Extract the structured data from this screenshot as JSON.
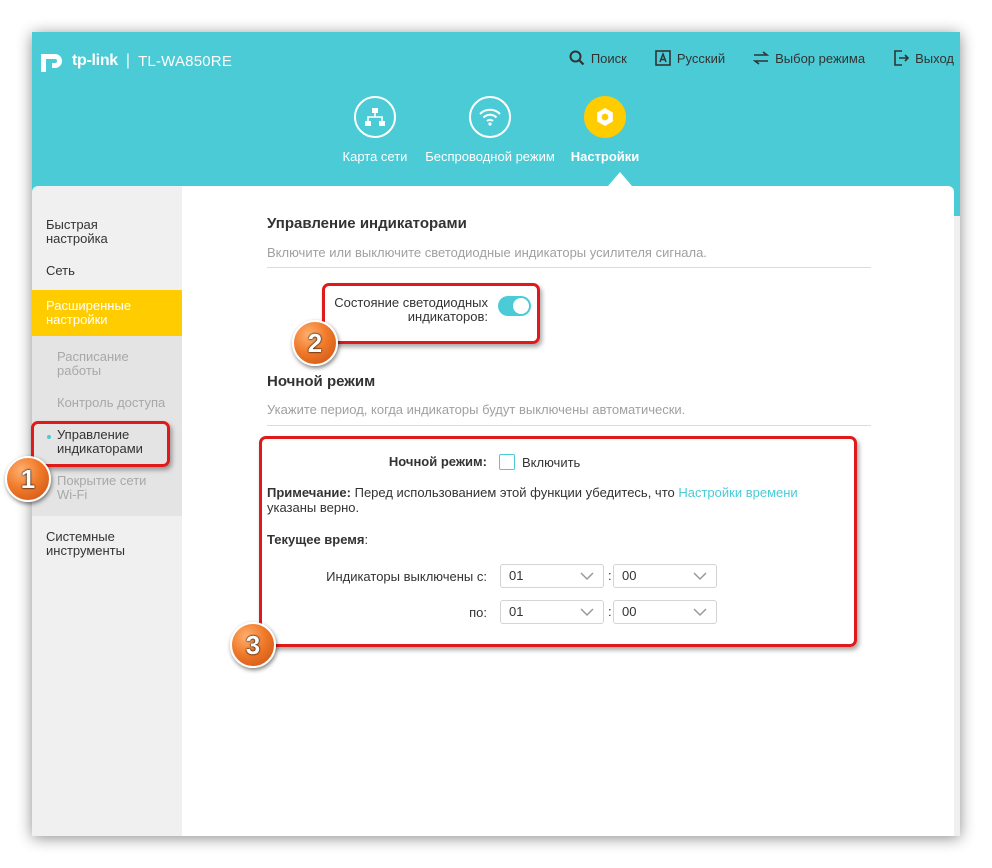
{
  "header": {
    "brand": "tp-link",
    "model": "TL-WA850RE",
    "top_menu": {
      "search": "Поиск",
      "language": "Русский",
      "mode": "Выбор режима",
      "logout": "Выход"
    },
    "nav": [
      {
        "label": "Карта сети"
      },
      {
        "label": "Беспроводной режим"
      },
      {
        "label": "Настройки"
      }
    ]
  },
  "sidebar": {
    "quick": "Быстрая настройка",
    "network": "Сеть",
    "advanced": "Расширенные настройки",
    "sub": {
      "schedule": "Расписание работы",
      "access": "Контроль доступа",
      "led": "Управление индикаторами",
      "coverage": "Покрытие сети Wi-Fi"
    },
    "tools": "Системные инструменты"
  },
  "main": {
    "led_title": "Управление индикаторами",
    "led_desc": "Включите или выключите светодиодные индикаторы усилителя сигнала.",
    "led_status_label": "Состояние светодиодных индикаторов:",
    "night_title": "Ночной режим",
    "night_desc": "Укажите период, когда индикаторы будут выключены автоматически.",
    "night_mode_label": "Ночной режим:",
    "enable_label": "Включить",
    "note_label": "Примечание:",
    "note_text_1": " Перед использованием этой функции убедитесь, что ",
    "note_link": "Настройки времени",
    "note_text_2": " указаны верно.",
    "current_time_label": "Текущее время",
    "current_time_colon": ":",
    "off_from_label": "Индикаторы выключены с:",
    "to_label": "по:",
    "from_hour": "01",
    "from_min": "00",
    "to_hour": "01",
    "to_min": "00",
    "colon": ":"
  },
  "annotations": {
    "badge1": "1",
    "badge2": "2",
    "badge3": "3"
  },
  "colors": {
    "accent": "#4acbd6",
    "active_nav": "#ffcc00",
    "callout": "#e01a1a"
  }
}
